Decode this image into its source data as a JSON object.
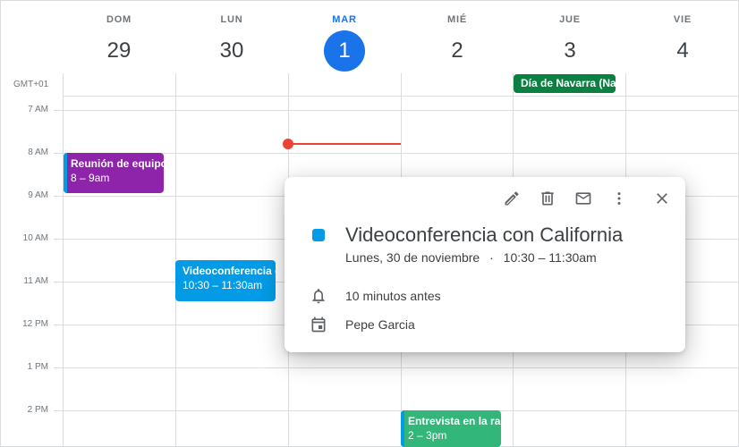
{
  "header": {
    "days": [
      {
        "dow": "DOM",
        "num": "29"
      },
      {
        "dow": "LUN",
        "num": "30"
      },
      {
        "dow": "MAR",
        "num": "1"
      },
      {
        "dow": "MIÉ",
        "num": "2"
      },
      {
        "dow": "JUE",
        "num": "3"
      },
      {
        "dow": "VIE",
        "num": "4"
      }
    ],
    "timezone": "GMT+01"
  },
  "hours": [
    "7 AM",
    "8 AM",
    "9 AM",
    "10 AM",
    "11 AM",
    "12 PM",
    "1 PM",
    "2 PM"
  ],
  "events": {
    "allday": {
      "title": "Día de Navarra (Na",
      "color": "#0b8043"
    },
    "team_meeting": {
      "title": "Reunión de equipo",
      "time": "8 – 9am",
      "color": "#8e24aa",
      "bar_color": "#039be5"
    },
    "videoconf": {
      "title": "Videoconferencia c",
      "time": "10:30 – 11:30am",
      "color": "#039be5"
    },
    "interview": {
      "title": "Entrevista en la rad",
      "time": "2 – 3pm",
      "color": "#33b679",
      "bar_color": "#039be5"
    }
  },
  "popup": {
    "title": "Videoconferencia con California",
    "date": "Lunes, 30 de noviembre",
    "separator": "·",
    "time": "10:30 – 11:30am",
    "reminder": "10 minutos antes",
    "calendar": "Pepe Garcia",
    "color": "#039be5",
    "icons": [
      "edit-icon",
      "delete-icon",
      "email-icon",
      "more-icon",
      "close-icon"
    ]
  }
}
